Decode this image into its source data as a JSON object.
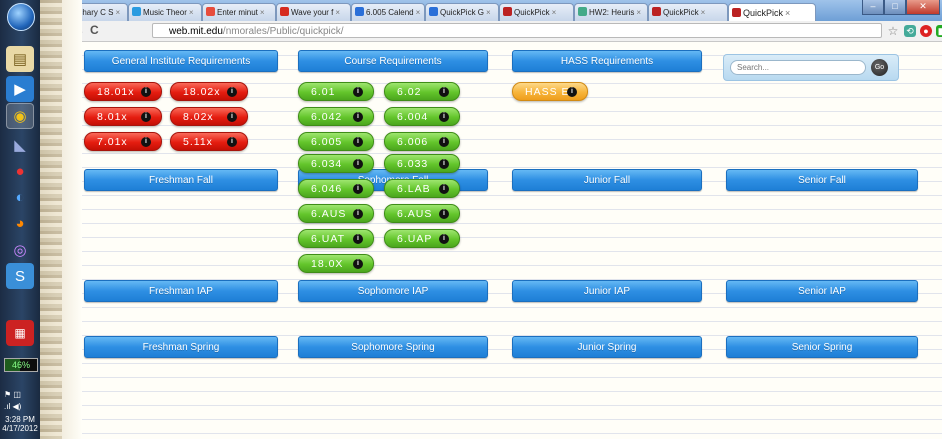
{
  "taskbar": {
    "battery": "46%",
    "battery_level": 0.46,
    "time": "3:28 PM",
    "date": "4/17/2012"
  },
  "browser": {
    "tabs": [
      {
        "label": "Zachary C S",
        "color": "#f4a742",
        "active": false
      },
      {
        "label": "Music Theor",
        "color": "#2a9be0",
        "active": false
      },
      {
        "label": "Enter minut",
        "color": "#e74c3c",
        "active": false
      },
      {
        "label": "Wave your f",
        "color": "#d62b1f",
        "active": false
      },
      {
        "label": "6.005 Calend",
        "color": "#2a6fd8",
        "active": false
      },
      {
        "label": "QuickPick G",
        "color": "#2a6fd8",
        "active": false
      },
      {
        "label": "QuickPick",
        "color": "#b22",
        "active": false
      },
      {
        "label": "HW2: Heuris",
        "color": "#4a8",
        "active": false
      },
      {
        "label": "QuickPick",
        "color": "#b22",
        "active": false
      },
      {
        "label": "QuickPick",
        "color": "#b22",
        "active": true
      }
    ],
    "url_host": "web.mit.edu",
    "url_path": "/nmorales/Public/quickpick/"
  },
  "requirements": {
    "gir": "General Institute Requirements",
    "course": "Course Requirements",
    "hass": "HASS Requirements"
  },
  "search": {
    "placeholder": "Search...",
    "go_label": "Go"
  },
  "gir_classes": [
    "18.01x",
    "18.02x",
    "8.01x",
    "8.02x",
    "7.01x",
    "5.11x"
  ],
  "course_classes": [
    "6.01",
    "6.02",
    "6.042",
    "6.004",
    "6.005",
    "6.006",
    "6.034",
    "6.033",
    "6.046",
    "6.LAB",
    "6.AUS",
    "6.AUS",
    "6.UAT",
    "6.UAP",
    "18.0X"
  ],
  "hass_classes": [
    "HASS E"
  ],
  "semesters": {
    "freshman_fall": "Freshman Fall",
    "sophomore_fall": "Sophomore Fall",
    "junior_fall": "Junior Fall",
    "senior_fall": "Senior Fall",
    "freshman_iap": "Freshman IAP",
    "sophomore_iap": "Sophomore IAP",
    "junior_iap": "Junior IAP",
    "senior_iap": "Senior IAP",
    "freshman_spring": "Freshman Spring",
    "sophomore_spring": "Sophomore Spring",
    "junior_spring": "Junior Spring",
    "senior_spring": "Senior Spring"
  },
  "info_glyph": "i"
}
